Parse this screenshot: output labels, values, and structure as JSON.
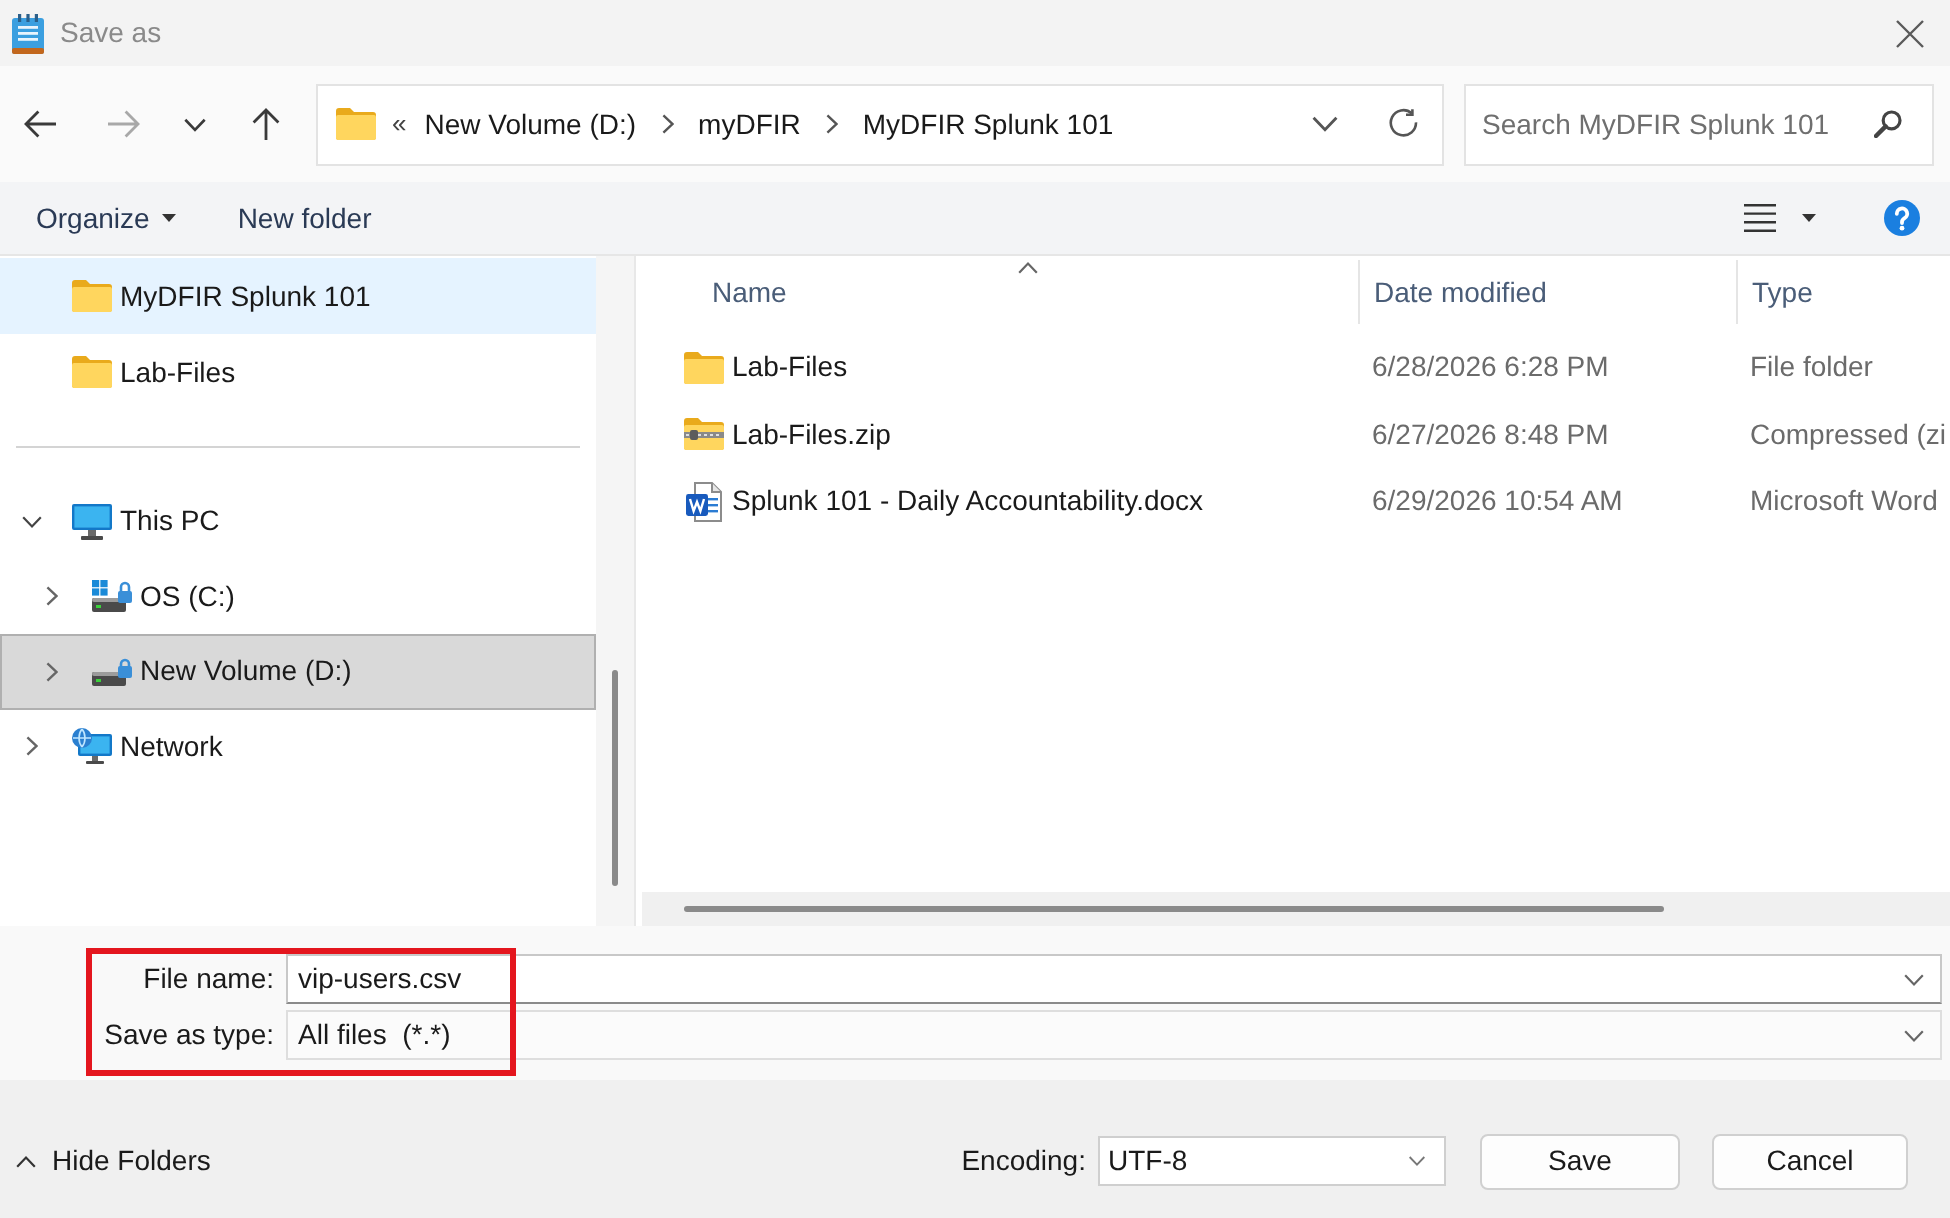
{
  "window": {
    "title": "Save as"
  },
  "nav_buttons": [
    {
      "kind": "back",
      "disabled": false
    },
    {
      "kind": "forward",
      "disabled": true
    },
    {
      "kind": "recent",
      "disabled": false
    },
    {
      "kind": "up",
      "disabled": false
    }
  ],
  "address_bar": {
    "overflow_marker": "«",
    "segments": [
      "New Volume (D:)",
      "myDFIR",
      "MyDFIR Splunk 101"
    ]
  },
  "search": {
    "placeholder": "Search MyDFIR Splunk 101"
  },
  "toolbar": {
    "items": [
      {
        "label": "Organize",
        "has_menu": true
      },
      {
        "label": "New folder",
        "has_menu": false
      }
    ]
  },
  "sidebar": {
    "pinned": [
      {
        "label": "MyDFIR Splunk 101",
        "kind": "folder",
        "selected": true
      },
      {
        "label": "Lab-Files",
        "kind": "folder",
        "selected": false
      }
    ],
    "tree": [
      {
        "label": "This PC",
        "kind": "pc",
        "expanded": true,
        "selected": false,
        "hovered": false,
        "children": [
          {
            "label": "OS (C:)",
            "kind": "system-drive",
            "expanded": false,
            "selected": false,
            "hovered": false
          },
          {
            "label": "New Volume (D:)",
            "kind": "drive",
            "expanded": false,
            "selected": false,
            "hovered": true
          }
        ]
      },
      {
        "label": "Network",
        "kind": "network",
        "expanded": false,
        "selected": false,
        "hovered": false
      }
    ]
  },
  "file_list": {
    "columns": [
      {
        "label": "Name",
        "sorted": true
      },
      {
        "label": "Date modified",
        "sorted": false
      },
      {
        "label": "Type",
        "sorted": false
      }
    ],
    "rows": [
      {
        "kind": "folder",
        "name": "Lab-Files",
        "date_modified": "6/28/2026 6:28 PM",
        "type": "File folder"
      },
      {
        "kind": "zip",
        "name": "Lab-Files.zip",
        "date_modified": "6/27/2026 8:48 PM",
        "type": "Compressed (zi"
      },
      {
        "kind": "word",
        "name": "Splunk 101 - Daily Accountability.docx",
        "date_modified": "6/29/2026 10:54 AM",
        "type": "Microsoft Word"
      }
    ]
  },
  "form": {
    "highlighted": true,
    "file_name": {
      "label": "File name:",
      "value": "vip-users.csv"
    },
    "save_as_type": {
      "label": "Save as type:",
      "value": "All files  (*.*)"
    }
  },
  "footer": {
    "hide_folders": "Hide Folders",
    "encoding": {
      "label": "Encoding:",
      "value": "UTF-8"
    },
    "buttons": [
      "Save",
      "Cancel"
    ]
  }
}
